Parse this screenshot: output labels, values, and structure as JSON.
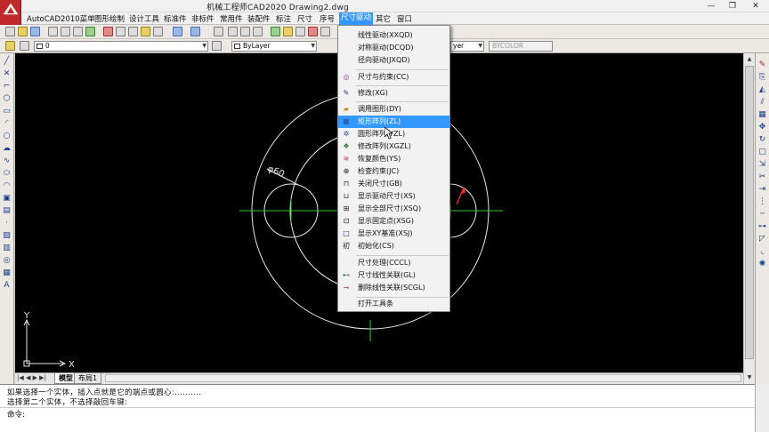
{
  "window": {
    "title": "机械工程师CAD2020      Drawing2.dwg",
    "min": "—",
    "restore": "❐",
    "close": "✕"
  },
  "menubar": {
    "items": [
      "AutoCAD2010菜单",
      "图形绘制",
      "设计工具",
      "标准件",
      "非标件",
      "常用件",
      "装配件",
      "标注",
      "尺寸",
      "序号",
      "尺寸驱动",
      "其它",
      "窗口"
    ],
    "active_index": 10
  },
  "toolbar2": {
    "layer_value": "0",
    "color_value": "ByLayer",
    "linetype_value": "yer",
    "plotstyle_value": "BYCOLOR"
  },
  "dropdown": {
    "items": [
      {
        "label": "线性驱动(XXQD)",
        "icon": ""
      },
      {
        "label": "对称驱动(DCQD)",
        "icon": ""
      },
      {
        "label": "径向驱动(JXQD)",
        "icon": ""
      },
      {
        "label": "尺寸与约束(CC)",
        "icon": "target-icon",
        "sep_before": true
      },
      {
        "label": "修改(XG)",
        "icon": "pen-icon",
        "sep_before": true
      },
      {
        "label": "调用图形(DY)",
        "icon": "folder-icon",
        "sep_before": true
      },
      {
        "label": "矩形阵列(ZL)",
        "icon": "grid-icon",
        "highlighted": true
      },
      {
        "label": "圆形阵列(YZL)",
        "icon": "circle-array-icon"
      },
      {
        "label": "修改阵列(XGZL)",
        "icon": "modify-array-icon"
      },
      {
        "label": "恢复颜色(YS)",
        "icon": "color-icon"
      },
      {
        "label": "检查约束(JC)",
        "icon": "check-icon"
      },
      {
        "label": "关闭尺寸(GB)",
        "icon": "dim-off-icon"
      },
      {
        "label": "显示驱动尺寸(XS)",
        "icon": "dim-show-icon"
      },
      {
        "label": "显示全部尺寸(XSQ)",
        "icon": "dim-all-icon"
      },
      {
        "label": "显示固定点(XSG)",
        "icon": "fixed-point-icon"
      },
      {
        "label": "显示XY基准(XSJ)",
        "icon": "xy-datum-icon"
      },
      {
        "label": "初始化(CS)",
        "icon": "init-icon"
      },
      {
        "label": "尺寸处理(CCCL)",
        "icon": "",
        "sep_before": true
      },
      {
        "label": "尺寸线性关联(GL)",
        "icon": "link-icon"
      },
      {
        "label": "删除线性关联(SCGL)",
        "icon": "unlink-icon"
      },
      {
        "label": "打开工具条",
        "icon": "",
        "sep_before": true
      }
    ]
  },
  "canvas": {
    "dimension_label": "φ60",
    "ucs_x": "X",
    "ucs_y": "Y"
  },
  "tabs": {
    "nav": "|◀ ◀ ▶ ▶|",
    "model": "模型",
    "layout1": "布局1"
  },
  "command": {
    "line1": "如果选择一个实体，插入点就是它的端点或圆心:..........",
    "line2": "选择第二个实体，不选择敲回车键:",
    "prompt": "命令:"
  }
}
